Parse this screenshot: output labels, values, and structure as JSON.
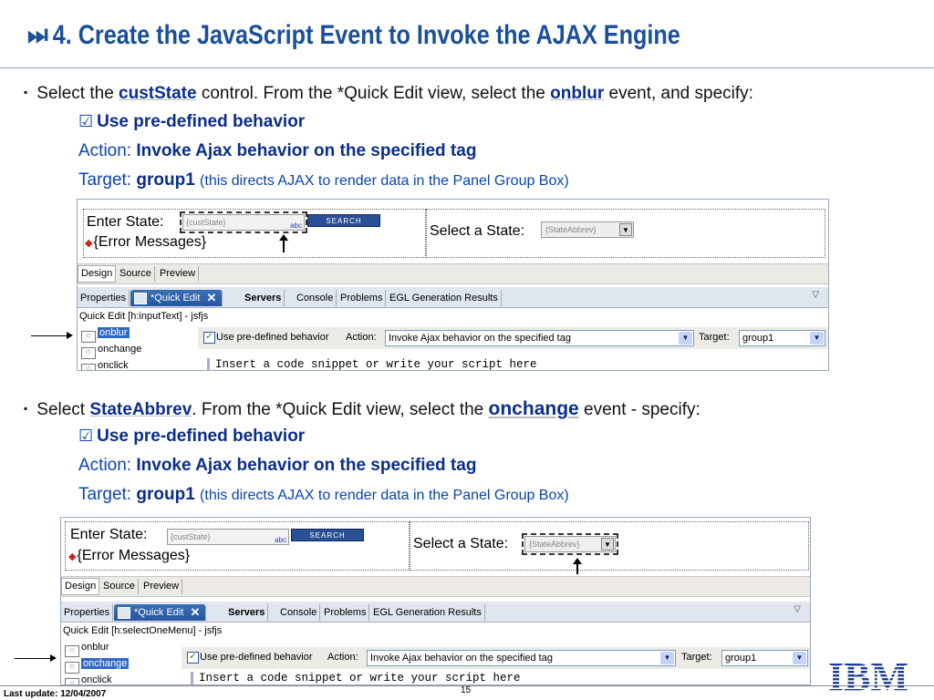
{
  "slide": {
    "title_glyph": "⏭",
    "title": "4. Create the JavaScript Event to Invoke the AJAX Engine",
    "footer": "Last update: 12/04/2007",
    "page_number": "15",
    "logo": "IBM"
  },
  "step1": {
    "bullet": "▪",
    "t1": "Select the ",
    "control": "custState",
    "t2": " control.  From the *Quick Edit view, select the ",
    "event": "onblur",
    "t3": " event, and specify:",
    "check": "☑",
    "use_predefined": "Use pre-defined behavior",
    "action_label": "Action: ",
    "action_value": "Invoke Ajax behavior on the specified tag",
    "target_label": "Target: ",
    "target_value": "group1",
    "target_note": "(this directs AJAX to render data in the Panel Group Box)"
  },
  "step2": {
    "bullet": "▪",
    "t1": "Select ",
    "control": "StateAbbrev",
    "t2": ".  From the *Quick Edit view, select the ",
    "event": "onchange",
    "t3": " event - specify:",
    "check": "☑",
    "use_predefined": "Use pre-defined behavior",
    "action_label": "Action: ",
    "action_value": "Invoke Ajax behavior on the specified tag",
    "target_label": "Target: ",
    "target_value": "group1",
    "target_note": "(this directs AJAX to render data in the Panel Group Box)"
  },
  "shot1": {
    "enter_state": "Enter State:",
    "cust_state": "{custState}",
    "abc": "abc",
    "search": "SEARCH",
    "error_messages": "{Error Messages}",
    "select_state": "Select a State:",
    "state_abbrev": "{StateAbbrev}",
    "dd_arrow": "▼",
    "editor_tabs": [
      "Design",
      "Source",
      "Preview"
    ],
    "view_tabs": [
      "Properties",
      "*Quick Edit",
      "Servers",
      "Console",
      "Problems",
      "EGL Generation Results"
    ],
    "close": "✕",
    "menu": "▽",
    "qe_header": "Quick Edit [h:inputText] - jsfjs",
    "events": [
      "onblur",
      "onchange",
      "onclick"
    ],
    "use_predefined": "Use pre-defined behavior",
    "action_label": "Action:",
    "action_value": "Invoke Ajax behavior on the specified tag",
    "target_label": "Target:",
    "target_value": "group1",
    "code": "Insert a code snippet or write your script here"
  },
  "shot2": {
    "enter_state": "Enter State:",
    "cust_state": "{custState}",
    "abc": "abc",
    "search": "SEARCH",
    "error_messages": "{Error Messages}",
    "select_state": "Select a State:",
    "state_abbrev": "{StateAbbrev}",
    "dd_arrow": "▼",
    "editor_tabs": [
      "Design",
      "Source",
      "Preview"
    ],
    "view_tabs": [
      "Properties",
      "*Quick Edit",
      "Servers",
      "Console",
      "Problems",
      "EGL Generation Results"
    ],
    "close": "✕",
    "menu": "▽",
    "qe_header": "Quick Edit [h:selectOneMenu] - jsfjs",
    "events": [
      "onblur",
      "onchange",
      "onclick"
    ],
    "use_predefined": "Use pre-defined behavior",
    "action_label": "Action:",
    "action_value": "Invoke Ajax behavior on the specified tag",
    "target_label": "Target:",
    "target_value": "group1",
    "code": "Insert a code snippet or write your script here"
  }
}
